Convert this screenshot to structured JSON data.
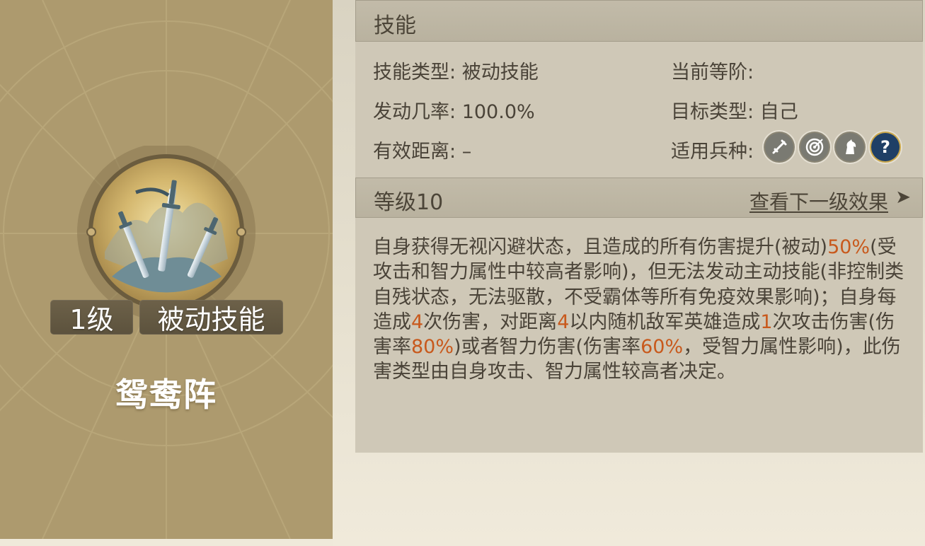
{
  "card": {
    "level_badge": "1级",
    "type_badge": "被动技能",
    "skill_name": "鸳鸯阵"
  },
  "skill_header": {
    "title": "技能"
  },
  "info": {
    "skill_type_label": "技能类型:",
    "skill_type_value": "被动技能",
    "current_rank_label": "当前等阶:",
    "current_rank_value": "",
    "trigger_rate_label": "发动几率:",
    "trigger_rate_value": "100.0%",
    "target_type_label": "目标类型:",
    "target_type_value": "自己",
    "range_label": "有效距离:",
    "range_value": "–",
    "troop_types_label": "适用兵种:",
    "troop_icons": [
      "sword-icon",
      "target-bow-icon",
      "horse-icon",
      "question-icon"
    ]
  },
  "level_header": {
    "title": "等级10",
    "next_link": "查看下一级效果",
    "arrow": "➤"
  },
  "description": {
    "segments": [
      {
        "text": "自身获得无视闪避状态，且造成的所有伤害提升(被动)",
        "hl": false
      },
      {
        "text": "50%",
        "hl": true
      },
      {
        "text": "(受攻击和智力属性中较高者影响)，但无法发动主动技能(非控制类自残状态，无法驱散，不受霸体等所有免疫效果影响)；自身每造成",
        "hl": false
      },
      {
        "text": "4",
        "hl": true
      },
      {
        "text": "次伤害，对距离",
        "hl": false
      },
      {
        "text": "4",
        "hl": true
      },
      {
        "text": "以内随机敌军英雄造成",
        "hl": false
      },
      {
        "text": "1",
        "hl": true
      },
      {
        "text": "次攻击伤害(伤害率",
        "hl": false
      },
      {
        "text": "80%",
        "hl": true
      },
      {
        "text": ")或者智力伤害(伤害率",
        "hl": false
      },
      {
        "text": "60%",
        "hl": true
      },
      {
        "text": "，受智力属性影响)，此伤害类型由自身攻击、智力属性较高者决定。",
        "hl": false
      }
    ]
  },
  "colors": {
    "card_bg": "#ad9a6e",
    "panel_bg": "#cfc8b7",
    "highlight": "#c8591c",
    "badge_bg": "#5f543f"
  }
}
